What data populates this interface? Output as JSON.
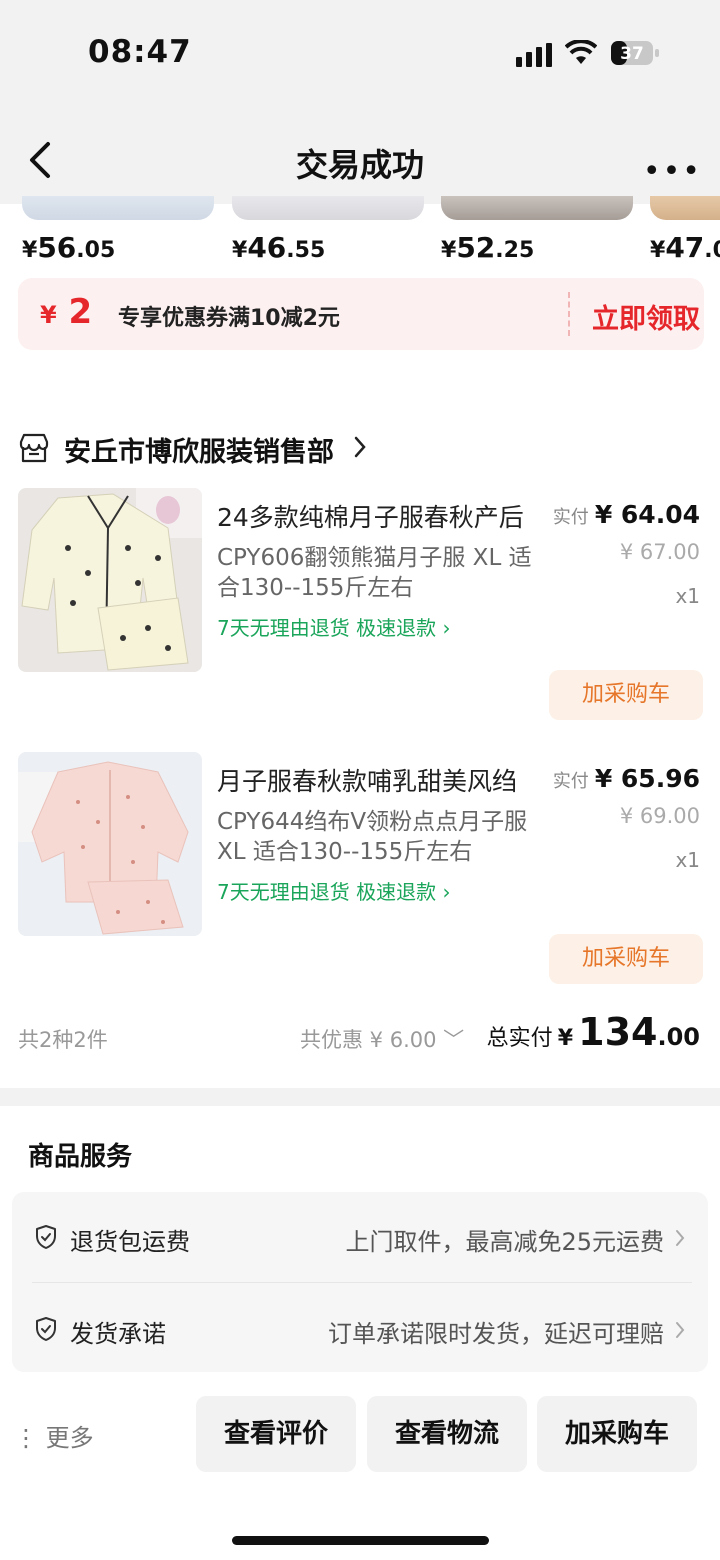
{
  "status": {
    "time": "08:47",
    "battery": "37"
  },
  "nav": {
    "title": "交易成功",
    "more": "•••"
  },
  "recommend": [
    {
      "cur": "¥",
      "int": "56",
      "dec": ".05"
    },
    {
      "cur": "¥",
      "int": "46",
      "dec": ".55"
    },
    {
      "cur": "¥",
      "int": "52",
      "dec": ".25"
    },
    {
      "cur": "¥",
      "int": "47",
      "dec": ".0"
    }
  ],
  "coupon": {
    "cur": "¥",
    "amount": "2",
    "desc": "专享优惠券满10减2元",
    "action": "立即领取"
  },
  "shop": {
    "name": "安丘市博欣服装销售部"
  },
  "items": [
    {
      "title": "24多款纯棉月子服春秋产后",
      "sku": "CPY606翻领熊猫月子服 XL 适合130--155斤左右",
      "service": "7天无理由退货  极速退款 ›",
      "paid_label": "实付",
      "paid": "¥ 64.04",
      "original": "¥ 67.00",
      "qty": "x1",
      "cart": "加采购车"
    },
    {
      "title": "月子服春秋款哺乳甜美风绉",
      "sku": "CPY644绉布V领粉点点月子服 XL 适合130--155斤左右",
      "service": "7天无理由退货  极速退款 ›",
      "paid_label": "实付",
      "paid": "¥ 65.96",
      "original": "¥ 69.00",
      "qty": "x1",
      "cart": "加采购车"
    }
  ],
  "summary": {
    "count": "共2种2件",
    "discount": "共优惠 ¥ 6.00 ﹀",
    "total_label": "总实付",
    "total_cur": "¥",
    "total_int": "134",
    "total_dec": ".00"
  },
  "services": {
    "title": "商品服务",
    "rows": [
      {
        "key": "退货包运费",
        "value": "上门取件，最高减免25元运费"
      },
      {
        "key": "发货承诺",
        "value": "订单承诺限时发货，延迟可理赔"
      }
    ]
  },
  "actions": {
    "more": "⋮ 更多",
    "review": "查看评价",
    "logistics": "查看物流",
    "cart": "加采购车"
  },
  "colors": {
    "accent_red": "#e5272b",
    "green": "#1aa55a",
    "orange": "#e6762a"
  }
}
